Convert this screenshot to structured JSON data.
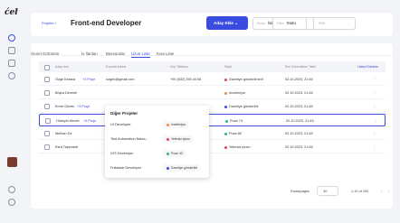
{
  "app": {
    "logo": "ćeł"
  },
  "header": {
    "breadcrumb": "Projeler /",
    "title": "Front-end Developer",
    "add_button": "Aday Ekle",
    "sort": {
      "label": "Sırala",
      "value": "İsim A-Z"
    },
    "filter": {
      "label": "Filtre",
      "value": "Statü"
    },
    "search_placeholder": "Ara"
  },
  "tabs": [
    "Genel Görünüm",
    "İş İlanları",
    "Başvurular",
    "Uzun Liste",
    "Kısa Liste"
  ],
  "table": {
    "columns": [
      "Aday İsmi",
      "E-posta Adresi",
      "Cep Telefonu",
      "Statü",
      "Son Güncelleme Tarihi"
    ],
    "edit_columns": "Listeyi Düzenle",
    "rows": [
      {
        "name": "Özge Karaca",
        "projects": "+3 Proje",
        "email": "ozgeh@gmail.com",
        "phone": "+90 (532) 255 44 66",
        "status": "Davetiye gönderilmedi",
        "date": "02.10.2023, 21:45"
      },
      {
        "name": "Büşra Demirel",
        "projects": "",
        "email": "",
        "phone": "",
        "status": "İnceleniyor",
        "date": "02.10.2023, 21:45"
      },
      {
        "name": "Emre Güven",
        "projects": "+3 Proje",
        "email": "",
        "phone": "",
        "status": "Davetiye gönderildi",
        "date": "02.10.2023, 21:45"
      },
      {
        "name": "Hüseyin Ahmet",
        "projects": "+4 Proje",
        "email": "",
        "phone": "",
        "status": "Puan 74",
        "date": "02.10.2023, 21:45"
      },
      {
        "name": "Melhan Öz",
        "projects": "",
        "email": "",
        "phone": "",
        "status": "Puan 80",
        "date": "02.10.2023, 21:45"
      },
      {
        "name": "Esra Taşevardi",
        "projects": "",
        "email": "",
        "phone": "",
        "status": "Yetersiz ipucu",
        "date": "02.10.2023, 21:45"
      }
    ]
  },
  "popover": {
    "title": "Diğer Projeler",
    "items": [
      {
        "project": "UI Developer",
        "status": "İnceleniyor"
      },
      {
        "project": "Test Automation Mana...",
        "status": "Yetersiz ipucu"
      },
      {
        "project": "IOS Developer",
        "status": "Puan 40"
      },
      {
        "project": "Fullstack Developer",
        "status": "Davetiye gönderildi"
      }
    ]
  },
  "pagination": {
    "rows_label": "Rows/pages",
    "rows_value": "10",
    "range": "1-10 of 100"
  },
  "colors": {
    "accent": "#3a4ce0",
    "status_red": "#e0474c",
    "status_orange": "#f08a3c",
    "status_blue": "#3a4ce0",
    "status_green": "#3bb36a"
  }
}
